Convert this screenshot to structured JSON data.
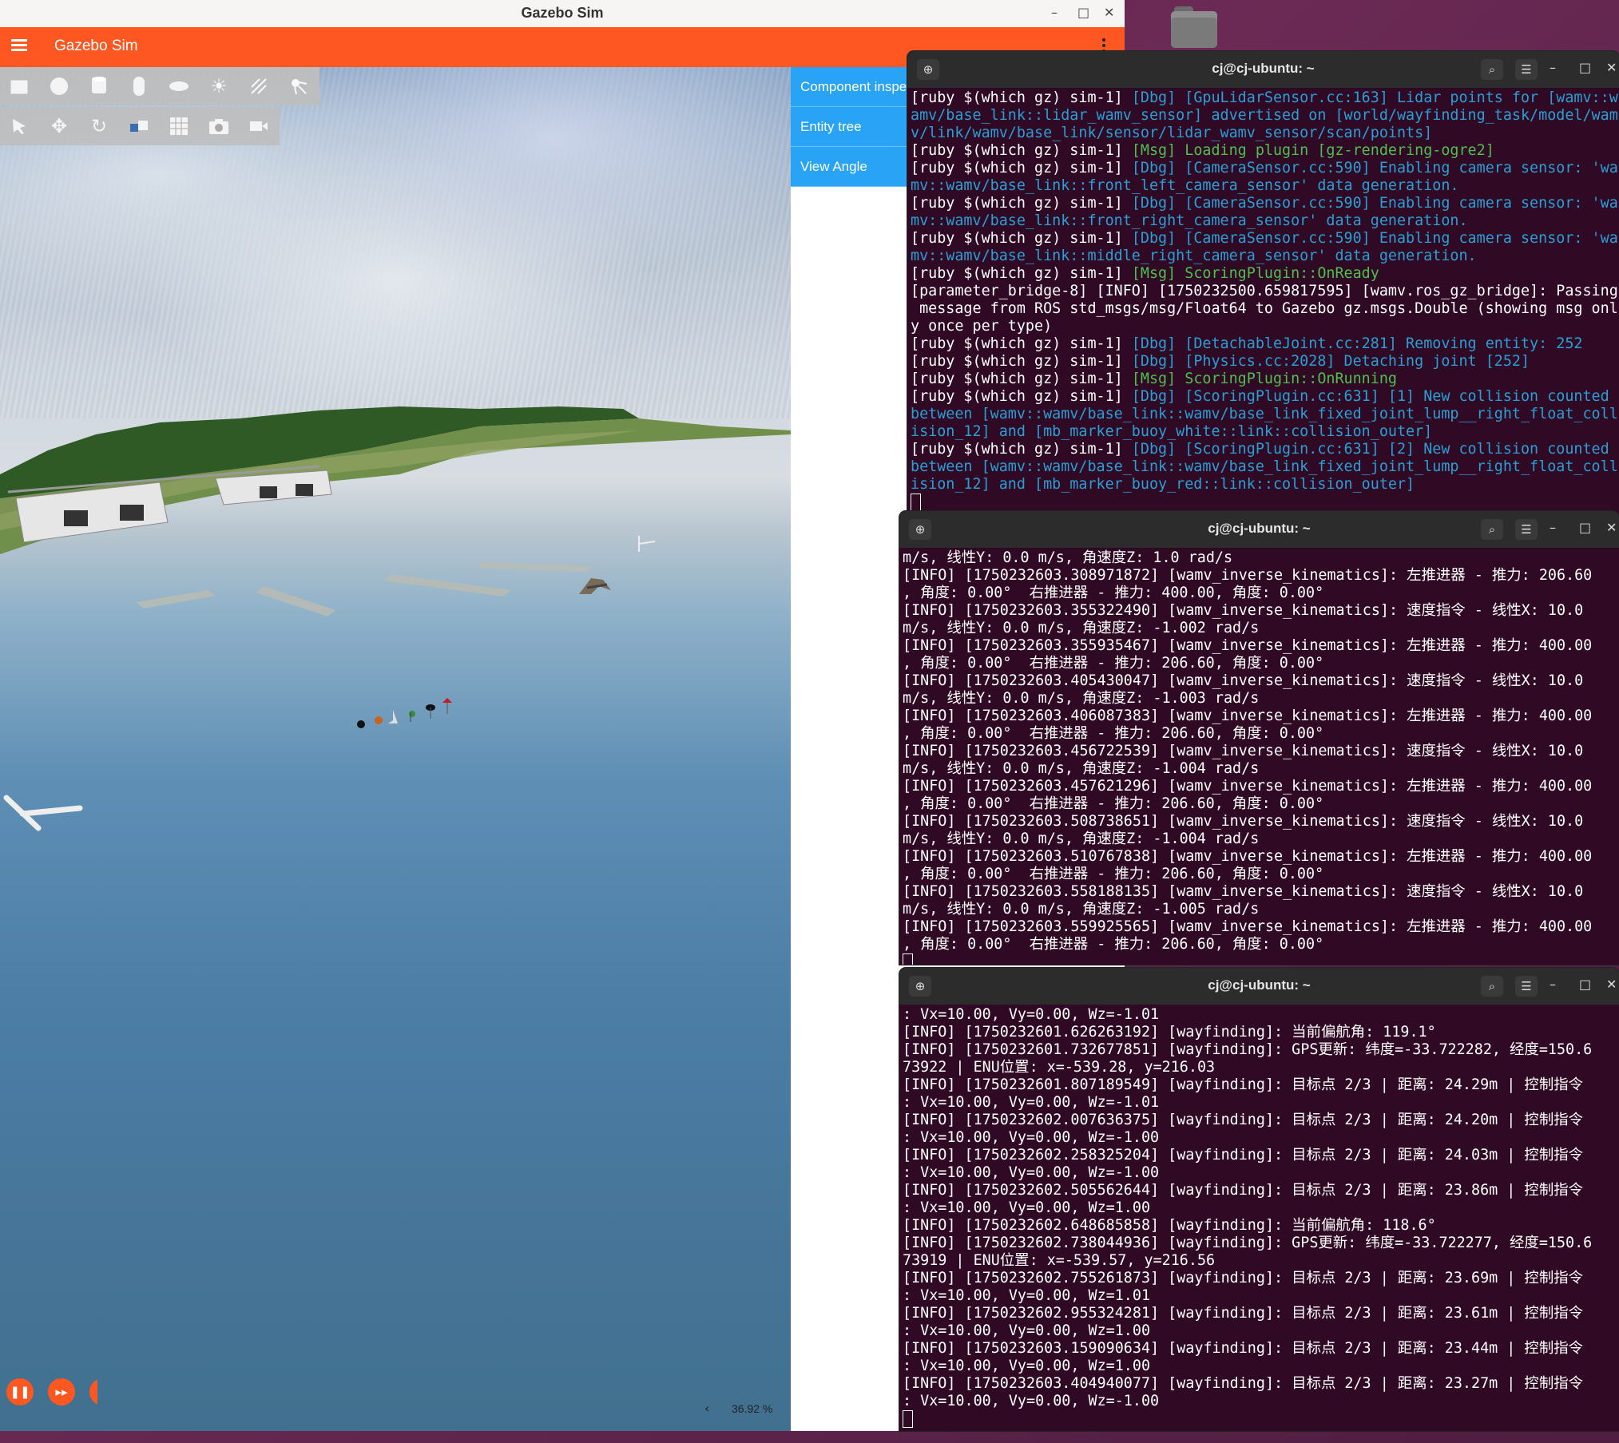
{
  "desktop": {
    "folder_icon": "folder-icon"
  },
  "gazebo": {
    "window_title": "Gazebo Sim",
    "app_name": "Gazebo Sim",
    "side_tabs": [
      "Component inspector",
      "Entity tree",
      "View Angle"
    ],
    "real_time_factor": "36.92 %",
    "toolbar_shapes": [
      "box-icon",
      "sphere-icon",
      "cylinder-icon",
      "capsule-icon",
      "ellipsoid-icon",
      "sun-icon",
      "directional-light-icon",
      "spot-light-icon"
    ],
    "toolbar_tools": [
      "select-icon",
      "translate-icon",
      "rotate-icon",
      "snap-icon",
      "grid-icon",
      "camera-icon",
      "video-icon"
    ]
  },
  "terminals": [
    {
      "title": "cj@cj-ubuntu: ~",
      "lines": [
        [
          [
            "t",
            "[ruby $(which gz) sim-1] "
          ],
          [
            "d",
            "[Dbg] [GpuLidarSensor.cc:163] Lidar points for [wamv::w"
          ]
        ],
        [
          [
            "d",
            "amv/base_link::lidar_wamv_sensor] advertised on [world/wayfinding_task/model/wam"
          ]
        ],
        [
          [
            "d",
            "v/link/wamv/base_link/sensor/lidar_wamv_sensor/scan/points]"
          ]
        ],
        [
          [
            "t",
            "[ruby $(which gz) sim-1] "
          ],
          [
            "m",
            "[Msg] Loading plugin [gz-rendering-ogre2]"
          ]
        ],
        [
          [
            "t",
            "[ruby $(which gz) sim-1] "
          ],
          [
            "d",
            "[Dbg] [CameraSensor.cc:590] Enabling camera sensor: 'wa"
          ]
        ],
        [
          [
            "d",
            "mv::wamv/base_link::front_left_camera_sensor' data generation."
          ]
        ],
        [
          [
            "t",
            "[ruby $(which gz) sim-1] "
          ],
          [
            "d",
            "[Dbg] [CameraSensor.cc:590] Enabling camera sensor: 'wa"
          ]
        ],
        [
          [
            "d",
            "mv::wamv/base_link::front_right_camera_sensor' data generation."
          ]
        ],
        [
          [
            "t",
            "[ruby $(which gz) sim-1] "
          ],
          [
            "d",
            "[Dbg] [CameraSensor.cc:590] Enabling camera sensor: 'wa"
          ]
        ],
        [
          [
            "d",
            "mv::wamv/base_link::middle_right_camera_sensor' data generation."
          ]
        ],
        [
          [
            "t",
            "[ruby $(which gz) sim-1] "
          ],
          [
            "m",
            "[Msg] ScoringPlugin::OnReady"
          ]
        ],
        [
          [
            "t",
            "[parameter_bridge-8] [INFO] [1750232500.659817595] [wamv.ros_gz_bridge]: Passing"
          ]
        ],
        [
          [
            "t",
            " message from ROS std_msgs/msg/Float64 to Gazebo gz.msgs.Double (showing msg onl"
          ]
        ],
        [
          [
            "t",
            "y once per type)"
          ]
        ],
        [
          [
            "t",
            "[ruby $(which gz) sim-1] "
          ],
          [
            "d",
            "[Dbg] [DetachableJoint.cc:281] Removing entity: 252"
          ]
        ],
        [
          [
            "t",
            "[ruby $(which gz) sim-1] "
          ],
          [
            "d",
            "[Dbg] [Physics.cc:2028] Detaching joint [252]"
          ]
        ],
        [
          [
            "t",
            "[ruby $(which gz) sim-1] "
          ],
          [
            "m",
            "[Msg] ScoringPlugin::OnRunning"
          ]
        ],
        [
          [
            "t",
            "[ruby $(which gz) sim-1] "
          ],
          [
            "d",
            "[Dbg] [ScoringPlugin.cc:631] [1] New collision counted"
          ]
        ],
        [
          [
            "d",
            "between [wamv::wamv/base_link::wamv/base_link_fixed_joint_lump__right_float_coll"
          ]
        ],
        [
          [
            "d",
            "ision_12] and [mb_marker_buoy_white::link::collision_outer]"
          ]
        ],
        [
          [
            "t",
            "[ruby $(which gz) sim-1] "
          ],
          [
            "d",
            "[Dbg] [ScoringPlugin.cc:631] [2] New collision counted"
          ]
        ],
        [
          [
            "d",
            "between [wamv::wamv/base_link::wamv/base_link_fixed_joint_lump__right_float_coll"
          ]
        ],
        [
          [
            "d",
            "ision_12] and [mb_marker_buoy_red::link::collision_outer]"
          ]
        ]
      ]
    },
    {
      "title": "cj@cj-ubuntu: ~",
      "lines": [
        [
          [
            "t",
            "m/s, 线性Y: 0.0 m/s, 角速度Z: 1.0 rad/s"
          ]
        ],
        [
          [
            "t",
            "[INFO] [1750232603.308971872] [wamv_inverse_kinematics]: 左推进器 - 推力: 206.60"
          ]
        ],
        [
          [
            "t",
            ", 角度: 0.00°  右推进器 - 推力: 400.00, 角度: 0.00°"
          ]
        ],
        [
          [
            "t",
            "[INFO] [1750232603.355322490] [wamv_inverse_kinematics]: 速度指令 - 线性X: 10.0"
          ]
        ],
        [
          [
            "t",
            "m/s, 线性Y: 0.0 m/s, 角速度Z: -1.002 rad/s"
          ]
        ],
        [
          [
            "t",
            "[INFO] [1750232603.355935467] [wamv_inverse_kinematics]: 左推进器 - 推力: 400.00"
          ]
        ],
        [
          [
            "t",
            ", 角度: 0.00°  右推进器 - 推力: 206.60, 角度: 0.00°"
          ]
        ],
        [
          [
            "t",
            "[INFO] [1750232603.405430047] [wamv_inverse_kinematics]: 速度指令 - 线性X: 10.0"
          ]
        ],
        [
          [
            "t",
            "m/s, 线性Y: 0.0 m/s, 角速度Z: -1.003 rad/s"
          ]
        ],
        [
          [
            "t",
            "[INFO] [1750232603.406087383] [wamv_inverse_kinematics]: 左推进器 - 推力: 400.00"
          ]
        ],
        [
          [
            "t",
            ", 角度: 0.00°  右推进器 - 推力: 206.60, 角度: 0.00°"
          ]
        ],
        [
          [
            "t",
            "[INFO] [1750232603.456722539] [wamv_inverse_kinematics]: 速度指令 - 线性X: 10.0"
          ]
        ],
        [
          [
            "t",
            "m/s, 线性Y: 0.0 m/s, 角速度Z: -1.004 rad/s"
          ]
        ],
        [
          [
            "t",
            "[INFO] [1750232603.457621296] [wamv_inverse_kinematics]: 左推进器 - 推力: 400.00"
          ]
        ],
        [
          [
            "t",
            ", 角度: 0.00°  右推进器 - 推力: 206.60, 角度: 0.00°"
          ]
        ],
        [
          [
            "t",
            "[INFO] [1750232603.508738651] [wamv_inverse_kinematics]: 速度指令 - 线性X: 10.0"
          ]
        ],
        [
          [
            "t",
            "m/s, 线性Y: 0.0 m/s, 角速度Z: -1.004 rad/s"
          ]
        ],
        [
          [
            "t",
            "[INFO] [1750232603.510767838] [wamv_inverse_kinematics]: 左推进器 - 推力: 400.00"
          ]
        ],
        [
          [
            "t",
            ", 角度: 0.00°  右推进器 - 推力: 206.60, 角度: 0.00°"
          ]
        ],
        [
          [
            "t",
            "[INFO] [1750232603.558188135] [wamv_inverse_kinematics]: 速度指令 - 线性X: 10.0"
          ]
        ],
        [
          [
            "t",
            "m/s, 线性Y: 0.0 m/s, 角速度Z: -1.005 rad/s"
          ]
        ],
        [
          [
            "t",
            "[INFO] [1750232603.559925565] [wamv_inverse_kinematics]: 左推进器 - 推力: 400.00"
          ]
        ],
        [
          [
            "t",
            ", 角度: 0.00°  右推进器 - 推力: 206.60, 角度: 0.00°"
          ]
        ]
      ]
    },
    {
      "title": "cj@cj-ubuntu: ~",
      "lines": [
        [
          [
            "t",
            ": Vx=10.00, Vy=0.00, Wz=-1.01"
          ]
        ],
        [
          [
            "t",
            "[INFO] [1750232601.626263192] [wayfinding]: 当前偏航角: 119.1°"
          ]
        ],
        [
          [
            "t",
            "[INFO] [1750232601.732677851] [wayfinding]: GPS更新: 纬度=-33.722282, 经度=150.6"
          ]
        ],
        [
          [
            "t",
            "73922 | ENU位置: x=-539.28, y=216.03"
          ]
        ],
        [
          [
            "t",
            "[INFO] [1750232601.807189549] [wayfinding]: 目标点 2/3 | 距离: 24.29m | 控制指令"
          ]
        ],
        [
          [
            "t",
            ": Vx=10.00, Vy=0.00, Wz=-1.01"
          ]
        ],
        [
          [
            "t",
            "[INFO] [1750232602.007636375] [wayfinding]: 目标点 2/3 | 距离: 24.20m | 控制指令"
          ]
        ],
        [
          [
            "t",
            ": Vx=10.00, Vy=0.00, Wz=-1.00"
          ]
        ],
        [
          [
            "t",
            "[INFO] [1750232602.258325204] [wayfinding]: 目标点 2/3 | 距离: 24.03m | 控制指令"
          ]
        ],
        [
          [
            "t",
            ": Vx=10.00, Vy=0.00, Wz=-1.00"
          ]
        ],
        [
          [
            "t",
            "[INFO] [1750232602.505562644] [wayfinding]: 目标点 2/3 | 距离: 23.86m | 控制指令"
          ]
        ],
        [
          [
            "t",
            ": Vx=10.00, Vy=0.00, Wz=1.00"
          ]
        ],
        [
          [
            "t",
            "[INFO] [1750232602.648685858] [wayfinding]: 当前偏航角: 118.6°"
          ]
        ],
        [
          [
            "t",
            "[INFO] [1750232602.738044936] [wayfinding]: GPS更新: 纬度=-33.722277, 经度=150.6"
          ]
        ],
        [
          [
            "t",
            "73919 | ENU位置: x=-539.57, y=216.56"
          ]
        ],
        [
          [
            "t",
            "[INFO] [1750232602.755261873] [wayfinding]: 目标点 2/3 | 距离: 23.69m | 控制指令"
          ]
        ],
        [
          [
            "t",
            ": Vx=10.00, Vy=0.00, Wz=1.01"
          ]
        ],
        [
          [
            "t",
            "[INFO] [1750232602.955324281] [wayfinding]: 目标点 2/3 | 距离: 23.61m | 控制指令"
          ]
        ],
        [
          [
            "t",
            ": Vx=10.00, Vy=0.00, Wz=1.00"
          ]
        ],
        [
          [
            "t",
            "[INFO] [1750232603.159090634] [wayfinding]: 目标点 2/3 | 距离: 23.44m | 控制指令"
          ]
        ],
        [
          [
            "t",
            ": Vx=10.00, Vy=0.00, Wz=1.00"
          ]
        ],
        [
          [
            "t",
            "[INFO] [1750232603.404940077] [wayfinding]: 目标点 2/3 | 距离: 23.27m | 控制指令"
          ]
        ],
        [
          [
            "t",
            ": Vx=10.00, Vy=0.00, Wz=-1.00"
          ]
        ]
      ]
    }
  ]
}
